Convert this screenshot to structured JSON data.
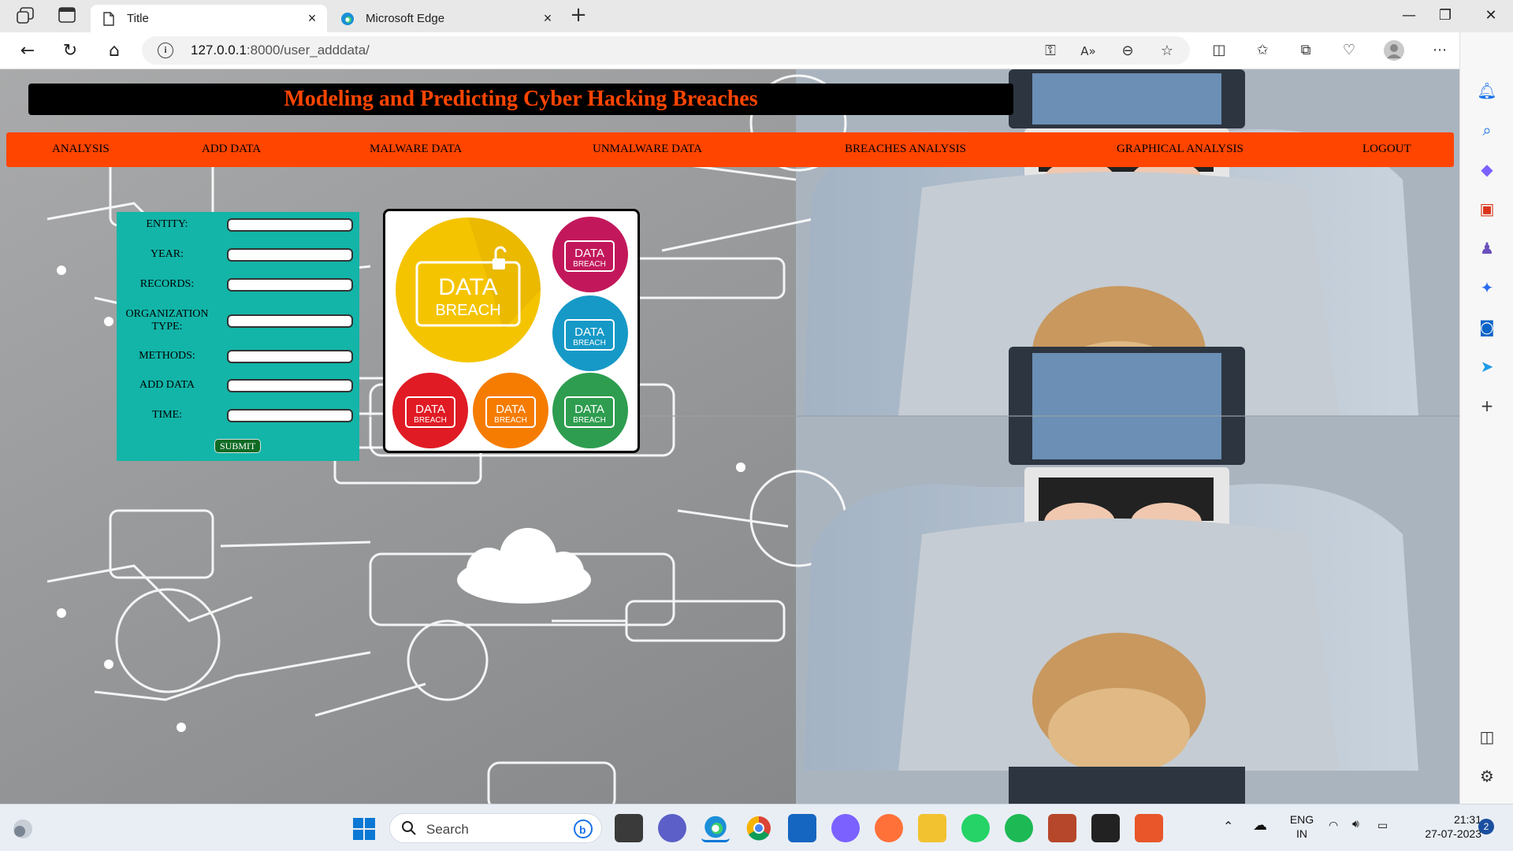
{
  "browser": {
    "tabs": [
      {
        "title": "Title",
        "active": true
      },
      {
        "title": "Microsoft Edge",
        "active": false
      }
    ],
    "address": {
      "host": "127.0.0.1",
      "path": ":8000/user_adddata/"
    }
  },
  "page": {
    "title": "Modeling and Predicting Cyber Hacking Breaches",
    "menu": [
      "ANALYSIS",
      "ADD DATA",
      "MALWARE DATA",
      "UNMALWARE DATA",
      "BREACHES ANALYSIS",
      "GRAPHICAL ANALYSIS",
      "LOGOUT"
    ],
    "form": {
      "fields": [
        {
          "label": "ENTITY:"
        },
        {
          "label": "YEAR:"
        },
        {
          "label": "RECORDS:"
        },
        {
          "label_line1": "ORGANIZATION",
          "label_line2": "TYPE:"
        },
        {
          "label": "METHODS:"
        },
        {
          "label": "ADD DATA"
        },
        {
          "label": "TIME:"
        }
      ],
      "submit": "SUBMIT"
    },
    "breach_image": {
      "big_line1": "DATA",
      "big_line2": "BREACH",
      "small_line1": "DATA",
      "small_line2": "BREACH",
      "colors": {
        "yellow": "#f5c400",
        "magenta": "#c2185b",
        "teal": "#1699c7",
        "red": "#e01b24",
        "orange": "#f57c00",
        "green": "#2e9d4f"
      }
    }
  },
  "taskbar": {
    "search_placeholder": "Search",
    "language_line1": "ENG",
    "language_line2": "IN",
    "time": "21:31",
    "date": "27-07-2023",
    "notification_count": "2"
  }
}
